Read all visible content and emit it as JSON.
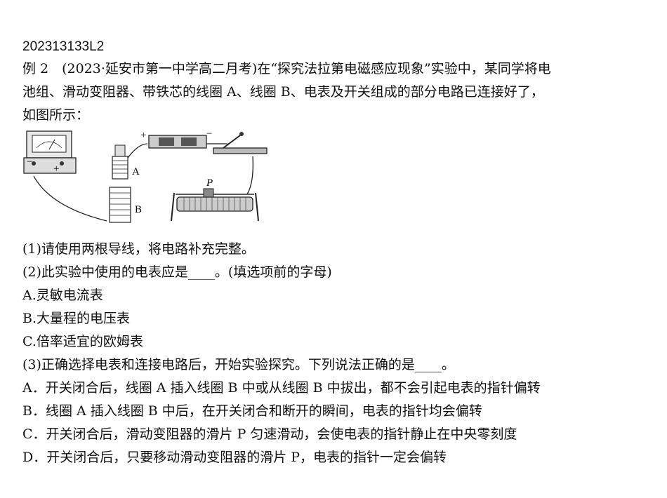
{
  "doc_code": "202313133L2",
  "example": {
    "line1": "例 2　(2023·延安市第一中学高二月考)在“探究法拉第电磁感应现象”实验中，某同学将电",
    "line2": "池组、滑动变阻器、带铁芯的线圈 A、线圈 B、电表及开关组成的部分电路已连接好了，",
    "line3": "如图所示："
  },
  "figure": {
    "label_a": "A",
    "label_b": "B",
    "label_p": "P",
    "plus": "+",
    "minus": "−"
  },
  "questions": {
    "q1": "(1)请使用两根导线，将电路补充完整。",
    "q2": "(2)此实验中使用的电表应是____。(填选项前的字母)",
    "q2_options": [
      "A.灵敏电流表",
      "B.大量程的电压表",
      "C.倍率适宜的欧姆表"
    ],
    "q3": "(3)正确选择电表和连接电路后，开始实验探究。下列说法正确的是____。",
    "q3_options": [
      "A．开关闭合后，线圈 A 插入线圈 B 中或从线圈 B 中拔出，都不会引起电表的指针偏转",
      "B．线圈 A 插入线圈 B 中后，在开关闭合和断开的瞬间，电表的指针均会偏转",
      "C．开关闭合后，滑动变阻器的滑片 P 匀速滑动，会使电表的指针静止在中央零刻度",
      "D．开关闭合后，只要移动滑动变阻器的滑片 P，电表的指针一定会偏转"
    ]
  }
}
